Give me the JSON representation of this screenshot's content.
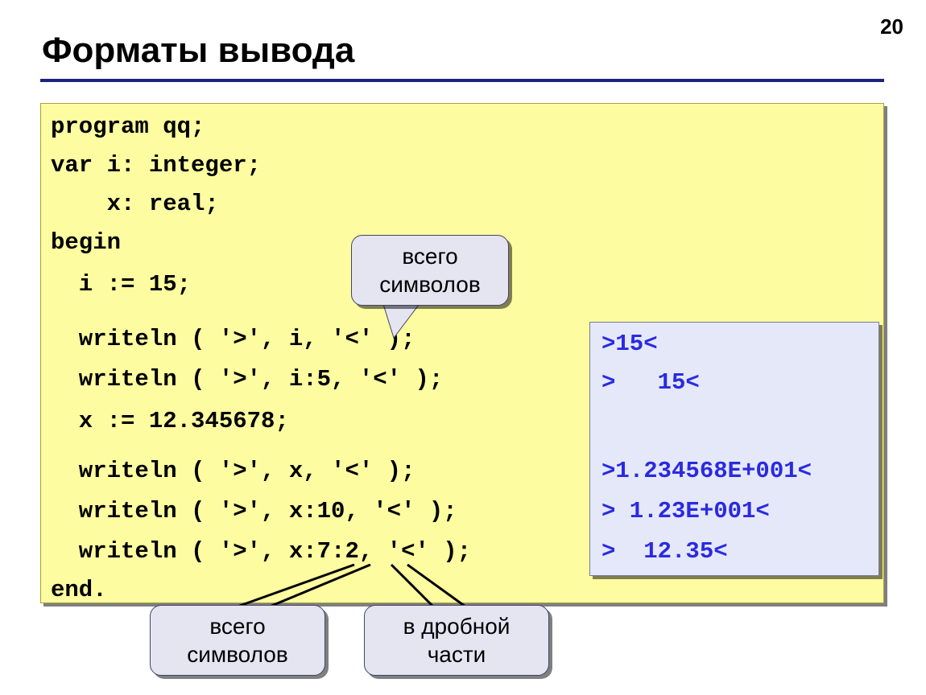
{
  "page_number": "20",
  "title": "Форматы вывода",
  "code": {
    "l1": "program qq;",
    "l2": "var i: integer;",
    "l3": "    x: real;",
    "l4": "begin",
    "l5": "  i := 15;",
    "l6": "  writeln ( '>', i, '<' );",
    "l7": "  writeln ( '>', i:5, '<' );",
    "l8": "  x := 12.345678;",
    "l9": "  writeln ( '>', x, '<' );",
    "l10": "  writeln ( '>', x:10, '<' );",
    "l11": "  writeln ( '>', x:7:2, '<' );",
    "l12": "end."
  },
  "output": {
    "o1": ">15<",
    "o2": ">   15<",
    "o3": ">1.234568E+001<",
    "o4": "> 1.23E+001<",
    "o5": ">  12.35<"
  },
  "callouts": {
    "top": {
      "l1": "всего",
      "l2": "символов"
    },
    "bottom_left": {
      "l1": "всего",
      "l2": "символов"
    },
    "bottom_right": {
      "l1": "в дробной",
      "l2": "части"
    }
  }
}
